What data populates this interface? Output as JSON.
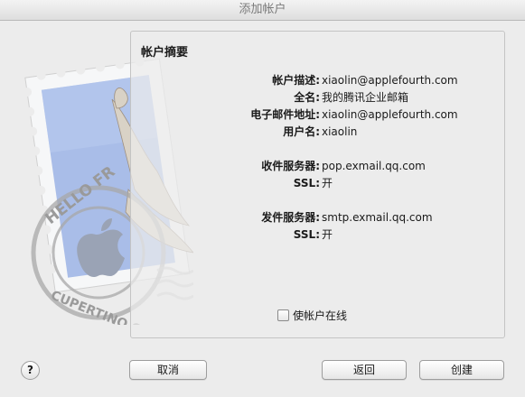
{
  "window": {
    "title": "添加帐户"
  },
  "summary": {
    "title": "帐户摘要",
    "rows": [
      {
        "label": "帐户描述:",
        "value": "xiaolin@applefourth.com"
      },
      {
        "label": "全名:",
        "value": "我的腾讯企业邮箱"
      },
      {
        "label": "电子邮件地址:",
        "value": "xiaolin@applefourth.com"
      },
      {
        "label": "用户名:",
        "value": "xiaolin"
      },
      {
        "label": "收件服务器:",
        "value": "pop.exmail.qq.com"
      },
      {
        "label": "SSL:",
        "value": "开"
      },
      {
        "label": "发件服务器:",
        "value": "smtp.exmail.qq.com"
      },
      {
        "label": "SSL:",
        "value": "开"
      }
    ],
    "online_checkbox": {
      "label": "使帐户在线",
      "checked": false
    }
  },
  "stamp": {
    "text_top": "HELLO FR",
    "text_bottom": "CUPERTINO CA"
  },
  "buttons": {
    "help": "?",
    "cancel": "取消",
    "back": "返回",
    "create": "创建"
  },
  "colors": {
    "stamp_sky": "#a9bde8",
    "stamp_paper": "#f6f7f8"
  }
}
